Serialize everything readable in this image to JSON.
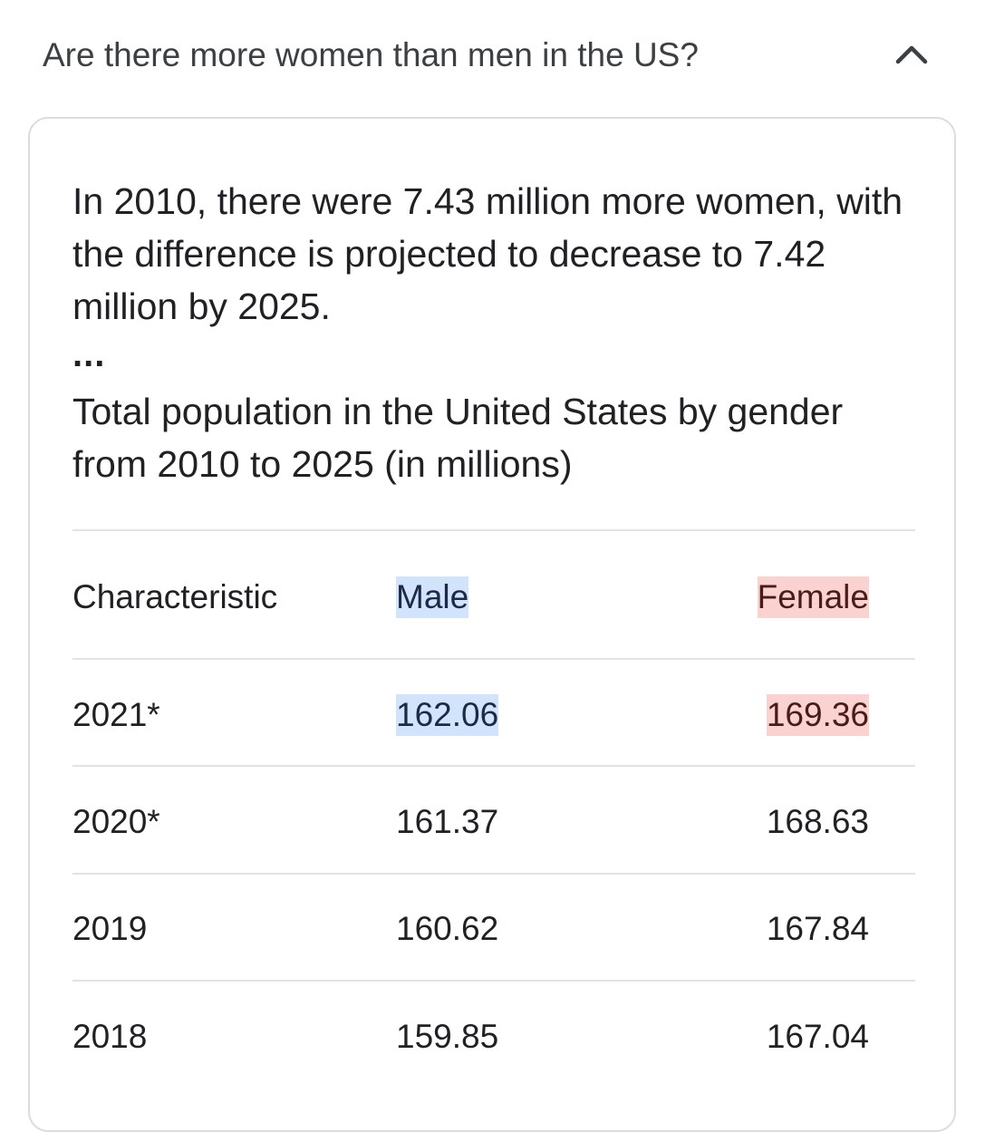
{
  "question": {
    "text": "Are there more women than men in the US?"
  },
  "icons": {
    "collapse": "chevron-up-icon"
  },
  "colors": {
    "male_highlight": "#d2e3fc",
    "female_highlight": "#fad2cf"
  },
  "answer": {
    "text": "In 2010, there were 7.43 million more women, with the difference is projected to decrease to 7.42 million by 2025.",
    "ellipsis": "...",
    "table_title": "Total population in the United States by gender from 2010 to 2025 (in millions)"
  },
  "table": {
    "headers": {
      "characteristic": "Characteristic",
      "male": "Male",
      "female": "Female"
    },
    "rows": [
      {
        "year": "2021*",
        "male": "162.06",
        "female": "169.36"
      },
      {
        "year": "2020*",
        "male": "161.37",
        "female": "168.63"
      },
      {
        "year": "2019",
        "male": "160.62",
        "female": "167.84"
      },
      {
        "year": "2018",
        "male": "159.85",
        "female": "167.04"
      }
    ]
  }
}
